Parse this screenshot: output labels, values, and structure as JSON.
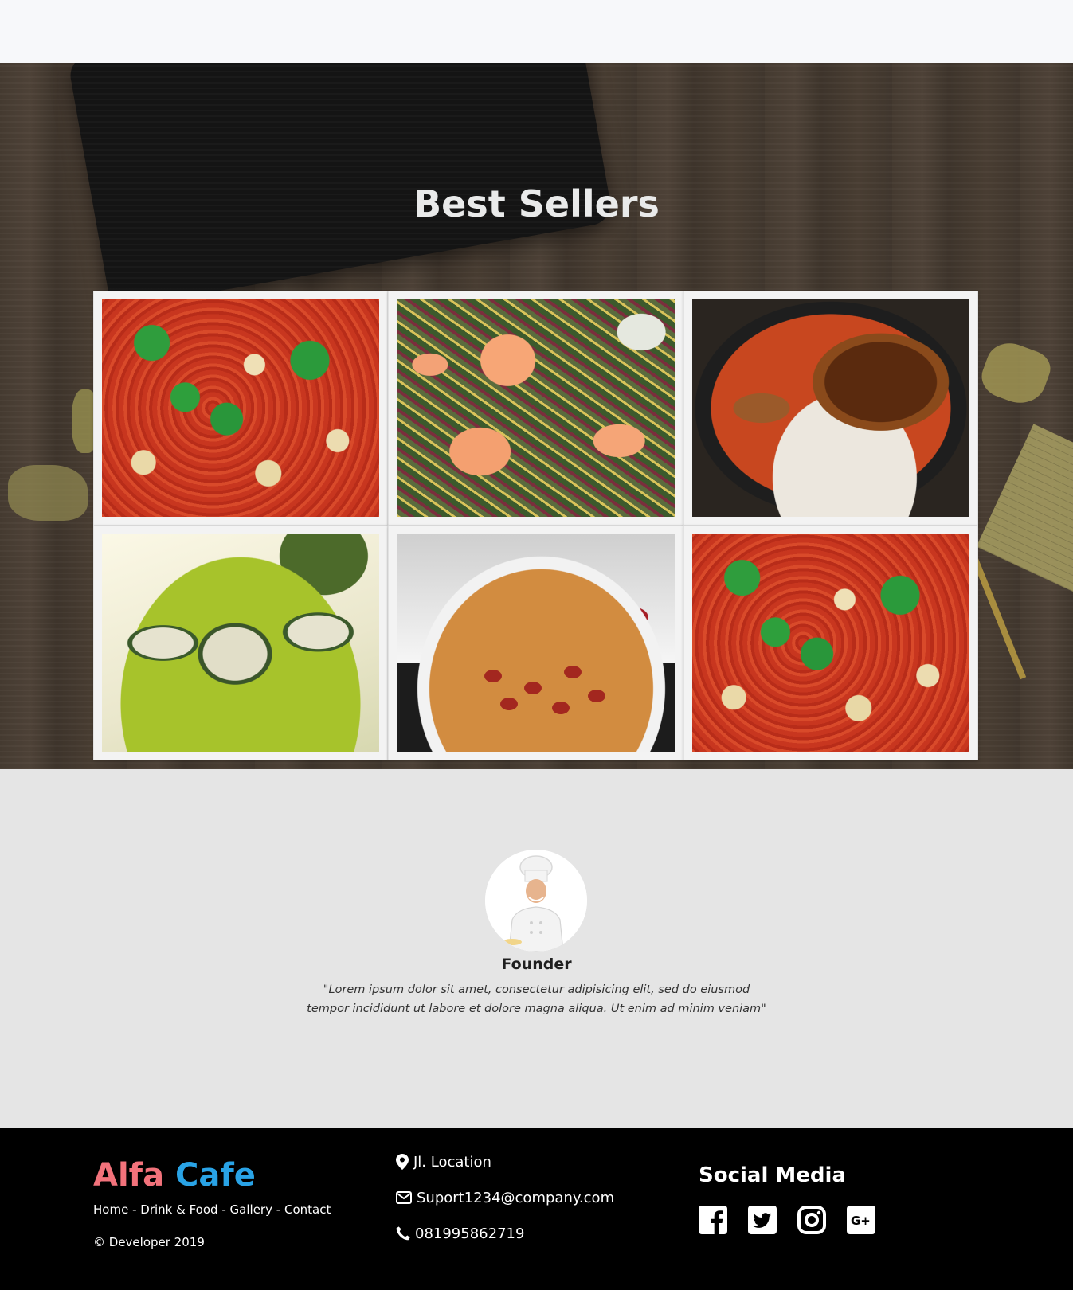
{
  "hero": {
    "title": "Best Sellers",
    "gallery": [
      {
        "alt": "Margherita pizza with basil"
      },
      {
        "alt": "Shrimp salad"
      },
      {
        "alt": "Eel rice bowl"
      },
      {
        "alt": "Sushi rolls in green bowl"
      },
      {
        "alt": "Pepperoni pizza with red wine"
      },
      {
        "alt": "Margherita pizza with basil"
      }
    ]
  },
  "founder": {
    "title": "Founder",
    "quote_line1": "\"Lorem ipsum dolor sit amet, consectetur adipisicing elit, sed do eiusmod",
    "quote_line2": "tempor incididunt ut labore et dolore magna aliqua. Ut enim ad minim veniam\""
  },
  "footer": {
    "brand_part1": "Alfa",
    "brand_part2": "Cafe",
    "nav": {
      "home": "Home",
      "drink_food": "Drink & Food",
      "gallery": "Gallery",
      "contact": "Contact",
      "separator": "-"
    },
    "copyright": "© Developer 2019",
    "contact": {
      "location": "Jl. Location",
      "email": "Suport1234@company.com",
      "phone": "081995862719"
    },
    "social_title": "Social Media",
    "social_icons": [
      "facebook-icon",
      "twitter-icon",
      "instagram-icon",
      "google-plus-icon"
    ],
    "colors": {
      "brand_part1": "#f2727b",
      "brand_part2": "#29a3e6",
      "background": "#000000"
    }
  }
}
